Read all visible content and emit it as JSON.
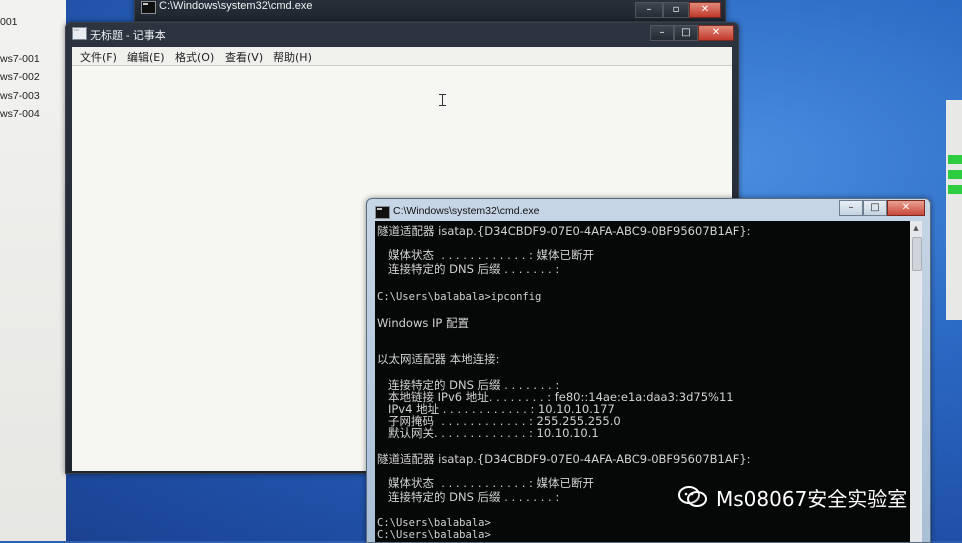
{
  "desktop": {
    "labels": [
      "001",
      "ws7-001",
      "ws7-002",
      "ws7-003",
      "ws7-004"
    ]
  },
  "bg_cmd": {
    "title": "C:\\Windows\\system32\\cmd.exe"
  },
  "notepad": {
    "title": "无标题 - 记事本",
    "menu": [
      "文件(F)",
      "编辑(E)",
      "格式(O)",
      "查看(V)",
      "帮助(H)"
    ],
    "content": ""
  },
  "cmd": {
    "title": "C:\\Windows\\system32\\cmd.exe",
    "lines": [
      "隧道适配器 isatap.{D34CBDF9-07E0-4AFA-ABC9-0BF95607B1AF}:",
      "   媒体状态  . . . . . . . . . . . . : 媒体已断开",
      "   连接特定的 DNS 后缀 . . . . . . . :",
      "C:\\Users\\balabala>ipconfig",
      "Windows IP 配置",
      "以太网适配器 本地连接:",
      "   连接特定的 DNS 后缀 . . . . . . . :",
      "   本地链接 IPv6 地址. . . . . . . . : fe80::14ae:e1a:daa3:3d75%11",
      "   IPv4 地址 . . . . . . . . . . . . : 10.10.10.177",
      "   子网掩码  . . . . . . . . . . . . : 255.255.255.0",
      "   默认网关. . . . . . . . . . . . . : 10.10.10.1",
      "隧道适配器 isatap.{D34CBDF9-07E0-4AFA-ABC9-0BF95607B1AF}:",
      "   媒体状态  . . . . . . . . . . . . : 媒体已断开",
      "   连接特定的 DNS 后缀 . . . . . . . :",
      "C:\\Users\\balabala>",
      "C:\\Users\\balabala>"
    ]
  },
  "watermark": {
    "text": "Ms08067安全实验室",
    "icon": "wechat-icon"
  },
  "colors": {
    "console_bg": "#060707",
    "console_fg": "#d2d2d2",
    "desktop": "#2b69c4"
  }
}
